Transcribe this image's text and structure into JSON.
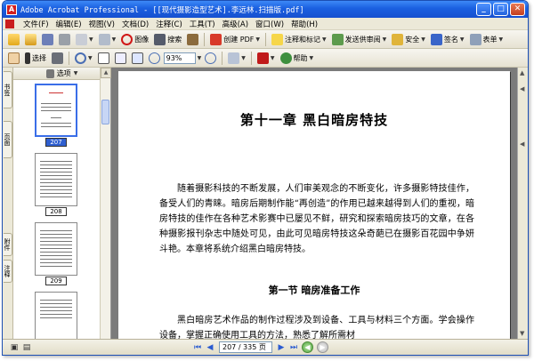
{
  "window": {
    "title": "Adobe Acrobat Professional - [[现代摄影造型艺术].李远林.扫描版.pdf]",
    "app_icon_letter": "A",
    "min_label": "_",
    "max_label": "□",
    "close_label": "✕"
  },
  "menubar": {
    "items": [
      "文件(F)",
      "编辑(E)",
      "视图(V)",
      "文档(D)",
      "注释(C)",
      "工具(T)",
      "高级(A)",
      "窗口(W)",
      "帮助(H)"
    ]
  },
  "toolbar1": {
    "search_label": "搜索",
    "create_pdf_label": "创建 PDF",
    "comment_label": "注释和标记",
    "send_review_label": "发送供审阅",
    "secure_label": "安全",
    "sign_label": "签名",
    "forms_label": "表单",
    "extra_label": "图像"
  },
  "toolbar2": {
    "select_label": "选择",
    "zoom_value": "93%",
    "help_label": "帮助"
  },
  "nav": {
    "tab_bookmarks": "书签",
    "tab_pages": "页面",
    "tab_attachments": "附件",
    "tab_comments": "注释",
    "options_label": "选项"
  },
  "thumbnails": [
    {
      "label": "207",
      "selected": true
    },
    {
      "label": "208",
      "selected": false
    },
    {
      "label": "209",
      "selected": false
    },
    {
      "label": "210",
      "selected": false
    }
  ],
  "document": {
    "chapter_title": "第十一章   黑白暗房特技",
    "para1": "随着摄影科技的不断发展，人们审美观念的不断变化，许多摄影特技佳作，备受人们的青睐。暗房后期制作能“再创造”的作用已越来越得到人们的重视，暗房特技的佳作在各种艺术影赛中已屡见不鲜，研究和探索暗房技巧的文章，在各种摄影报刊杂志中随处可见，由此可见暗房特技这朵奇葩已在摄影百花园中争妍斗艳。本章将系统介绍黑白暗房特技。",
    "section_title": "第一节    暗房准备工作",
    "para2": "黑白暗房艺术作品的制作过程涉及到设备、工具与材料三个方面。学会操作设备，掌握正确使用工具的方法，熟悉了解所需材"
  },
  "statusbar": {
    "page_indicator": "207 / 335 页"
  }
}
